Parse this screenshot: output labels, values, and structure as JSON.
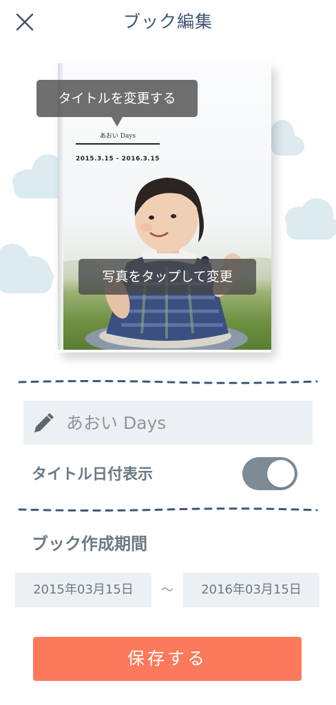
{
  "header": {
    "title": "ブック編集",
    "close_icon": "close-icon"
  },
  "book": {
    "cover_title": "あおい Days",
    "cover_dates": "2015.3.15 - 2016.3.15",
    "title_tooltip": "タイトルを変更する",
    "photo_tooltip": "写真をタップして変更"
  },
  "form": {
    "title_value": "あおい Days",
    "edit_icon": "pencil-icon",
    "toggle_label": "タイトル日付表示",
    "toggle_on": true,
    "period_label": "ブック作成期間",
    "start_date": "2015年03月15日",
    "separator": "～",
    "end_date": "2016年03月15日",
    "save_label": "保存する"
  },
  "colors": {
    "accent": "#fb7a5b",
    "header_text": "#3d5570",
    "label_text": "#6b7885",
    "input_bg": "#ecf0f2",
    "toggle_track": "#7d8b95",
    "dash": "#3f5775",
    "cloud": "#dcebf0"
  }
}
